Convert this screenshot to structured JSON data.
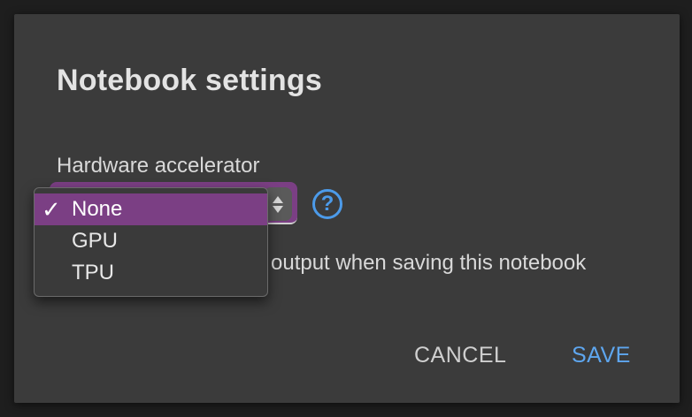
{
  "dialog": {
    "title": "Notebook settings",
    "hardware_label": "Hardware accelerator",
    "help_glyph": "?",
    "omit_text": "output when saving this notebook",
    "buttons": {
      "cancel": "CANCEL",
      "save": "SAVE"
    }
  },
  "dropdown": {
    "check_glyph": "✓",
    "items": [
      {
        "label": "None",
        "selected": true
      },
      {
        "label": "GPU",
        "selected": false
      },
      {
        "label": "TPU",
        "selected": false
      }
    ]
  },
  "colors": {
    "accent_purple": "#7b3f84",
    "link_blue": "#5ea6ef",
    "dialog_bg": "#3b3b3b"
  },
  "icons": {
    "help": "help-circle-icon",
    "check": "checkmark-icon",
    "stepper": "up-down-stepper-icon"
  }
}
